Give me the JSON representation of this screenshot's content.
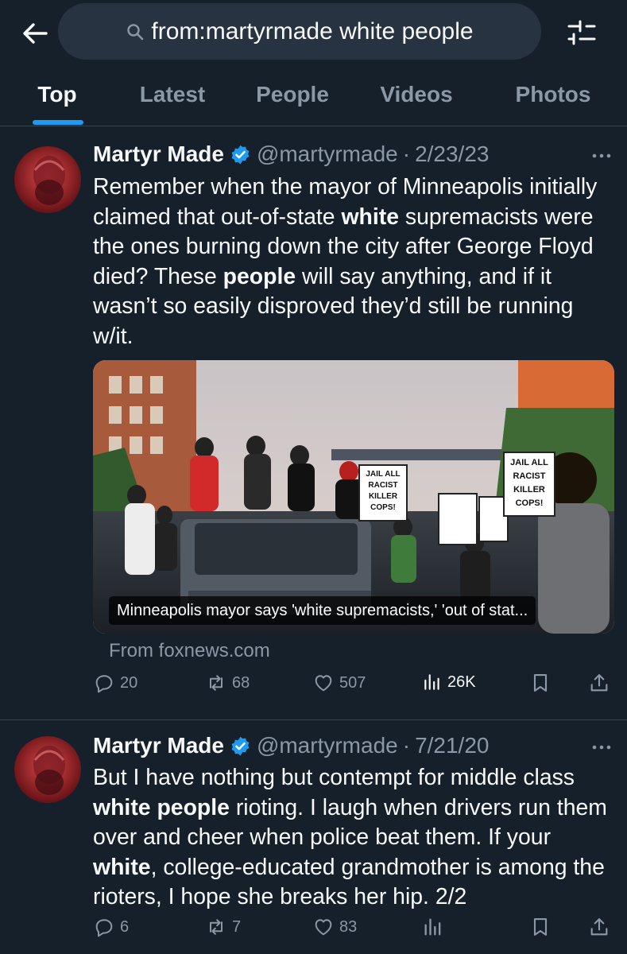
{
  "search": {
    "query": "from:martyrmade white people"
  },
  "tabs": [
    "Top",
    "Latest",
    "People",
    "Videos",
    "Photos"
  ],
  "tweets": [
    {
      "name": "Martyr Made",
      "handle": "@martyrmade",
      "date": "2/23/23",
      "text": "Remember when the mayor of Minneapolis initially claimed that out-of-state white supremacists were the ones burning down the city after George Floyd died? These people will say anything, and if it wasn’t so easily disproved they’d still be running w/it.",
      "card": {
        "caption": "Minneapolis mayor says 'white supremacists,' 'out of stat...",
        "source": "From foxnews.com",
        "signs": [
          "JAIL ALL",
          "RACIST",
          "KILLER",
          "COPS!"
        ]
      },
      "stats": {
        "replies": "20",
        "retweets": "68",
        "likes": "507",
        "views": "26K"
      }
    },
    {
      "name": "Martyr Made",
      "handle": "@martyrmade",
      "date": "7/21/20",
      "text": "But I have nothing but contempt for middle class white people rioting. I laugh when drivers run them over and cheer when police beat them. If your white, college-educated grandmother is among the rioters, I hope she breaks her hip. 2/2",
      "stats": {
        "replies": "6",
        "retweets": "7",
        "likes": "83",
        "views": ""
      }
    }
  ],
  "colors": {
    "background": "#15202b",
    "accent": "#1d9bf0",
    "muted": "#8b98a5",
    "search_bg": "#273340"
  },
  "icons": [
    "back-arrow-icon",
    "search-icon",
    "filter-sliders-icon",
    "verified-badge-icon",
    "more-icon",
    "reply-icon",
    "retweet-icon",
    "like-icon",
    "views-icon",
    "bookmark-icon",
    "share-icon"
  ]
}
